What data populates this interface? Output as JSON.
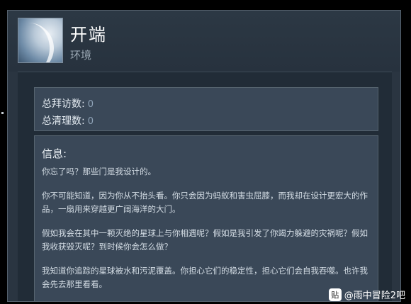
{
  "header": {
    "title": "开端",
    "subtitle": "环境"
  },
  "stats": {
    "visits_label": "总拜访数:",
    "visits_value": "0",
    "cleanups_label": "总清理数:",
    "cleanups_value": "0"
  },
  "info": {
    "heading": "信息:",
    "paragraphs": [
      "你忘了吗？那些门是我设计的。",
      "你不可能知道，因为你从不抬头看。你只会因为蚂蚁和害虫屈膝，而我却在设计更宏大的作品，一扇用来穿越更广阔海洋的大门。",
      "假如我会在其中一颗灭绝的星球上与你相遇呢？假如是我引发了你竭力躲避的灾祸呢？假如我收获毁灭呢？到时候你会怎么做？",
      "我知道你追踪的星球被水和污泥覆盖。你担心它们的稳定性，担心它们会自我吞噬。也许我会先去那里看看。"
    ]
  },
  "watermark": {
    "logo_text": "贴",
    "text": "@雨中冒险2吧"
  },
  "colors": {
    "frame_bg": "#2a3541",
    "panel_bg": "#212c37",
    "box_bg": "#3a4858",
    "value_color": "#8fa3b7"
  },
  "icons": [
    "avatar-image",
    "tieba-logo-icon"
  ]
}
